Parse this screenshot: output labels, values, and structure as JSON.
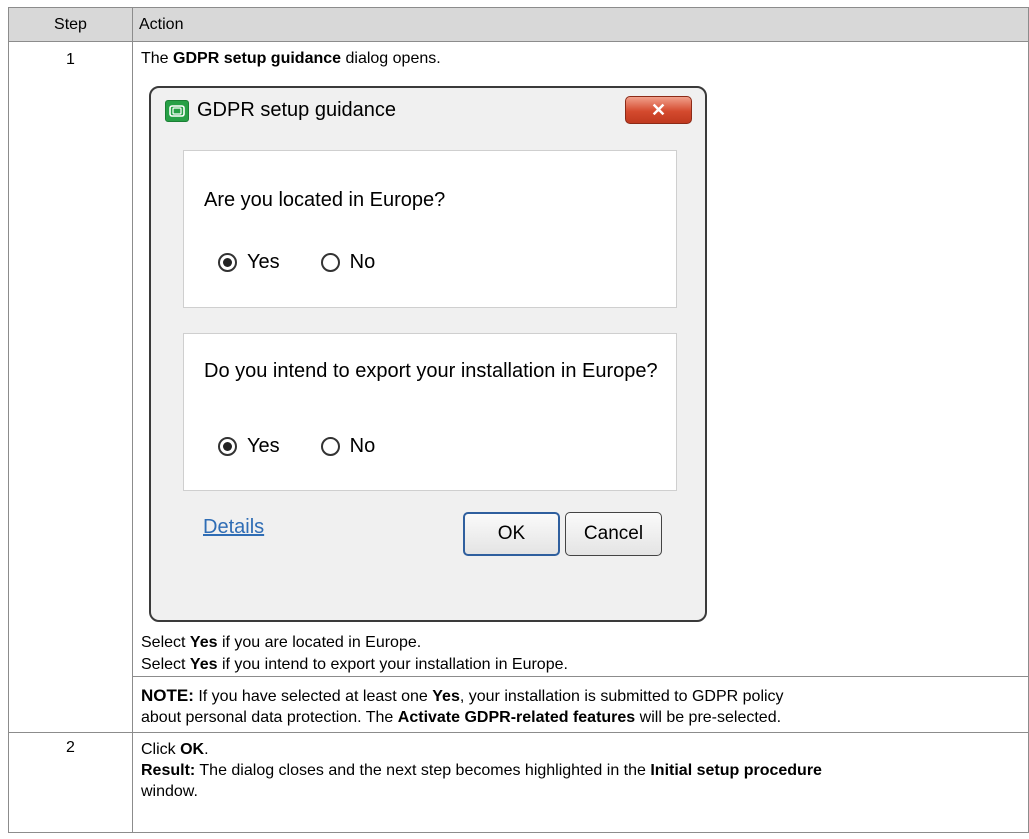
{
  "table": {
    "header": {
      "step": "Step",
      "action": "Action"
    },
    "row1": {
      "step": "1",
      "intro": {
        "pre": "The ",
        "bold": "GDPR setup guidance",
        "post": " dialog opens."
      },
      "select_line1": {
        "pre": "Select ",
        "bold": "Yes",
        "post": " if you are located in Europe."
      },
      "select_line2": {
        "pre": "Select ",
        "bold": "Yes",
        "post": " if you intend to export your installation in Europe."
      },
      "note": {
        "label": "NOTE:",
        "text1": " If you have selected at least one ",
        "bold1": "Yes",
        "text2": ", your installation is submitted to GDPR policy",
        "text3": "about personal data protection. The ",
        "bold2": "Activate GDPR-related features",
        "text4": " will be pre-selected."
      }
    },
    "row2": {
      "step": "2",
      "line1": {
        "pre": "Click ",
        "bold": "OK",
        "post": "."
      },
      "line2": {
        "bold": "Result:",
        "text": " The dialog closes and the next step becomes highlighted in the ",
        "bold2": "Initial setup procedure"
      },
      "line3": "window."
    }
  },
  "dialog": {
    "title": "GDPR setup guidance",
    "close_icon": "close-x-icon",
    "app_icon": "gdpr-app-icon",
    "q1": {
      "question": "Are you located in Europe?",
      "options": [
        "Yes",
        "No"
      ],
      "selected": "Yes"
    },
    "q2": {
      "question": "Do you intend to export your installation in Europe?",
      "options": [
        "Yes",
        "No"
      ],
      "selected": "Yes"
    },
    "details_link": "Details",
    "ok_label": "OK",
    "cancel_label": "Cancel",
    "colors": {
      "close": "#d44a2e",
      "link": "#2f6db5",
      "app_icon": "#27a046",
      "header_bg": "#d8d8d8"
    }
  }
}
